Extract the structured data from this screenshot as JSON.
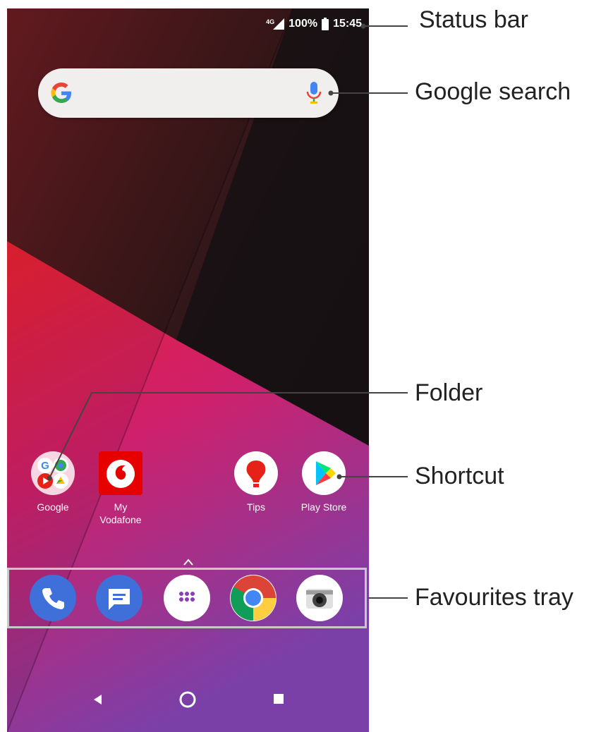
{
  "status_bar": {
    "network": "4G",
    "battery": "100%",
    "time": "15:45"
  },
  "search": {
    "logo_icon": "google-g-icon",
    "mic_icon": "mic-icon"
  },
  "home_apps": [
    {
      "label": "Google",
      "icon": "folder-icon"
    },
    {
      "label": "My\nVodafone",
      "icon": "vodafone-icon"
    },
    {
      "label": "Tips",
      "icon": "tips-icon"
    },
    {
      "label": "Play Store",
      "icon": "play-store-icon"
    }
  ],
  "favourites": [
    {
      "icon": "phone-icon"
    },
    {
      "icon": "messages-icon"
    },
    {
      "icon": "app-drawer-icon"
    },
    {
      "icon": "chrome-icon"
    },
    {
      "icon": "camera-icon"
    }
  ],
  "nav_bar": {
    "back": "back-icon",
    "home": "home-icon",
    "recents": "recents-icon"
  },
  "callouts": {
    "status_bar": "Status bar",
    "google_search": "Google search",
    "folder": "Folder",
    "shortcut": "Shortcut",
    "favourites_tray": "Favourites tray"
  },
  "colors": {
    "vodafone_red": "#e60000",
    "wallpaper_red": "#e8242c",
    "wallpaper_purple": "#7b3aa6"
  }
}
